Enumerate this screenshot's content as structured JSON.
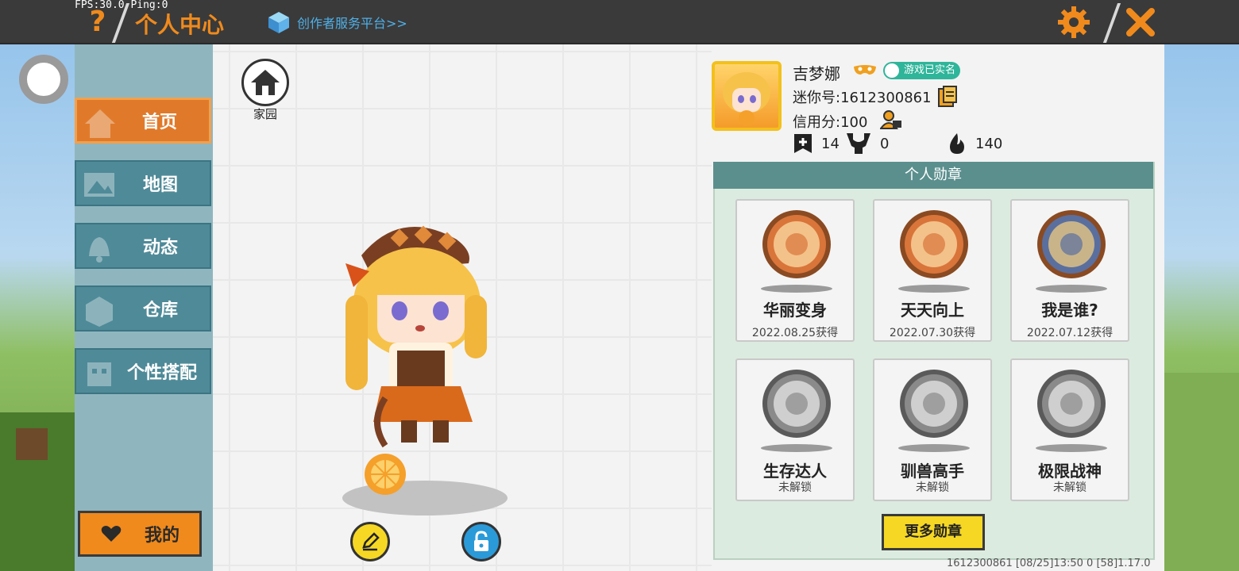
{
  "overlay": {
    "fps_text": "FPS:30.0  Ping:0"
  },
  "header": {
    "title": "个人中心",
    "help_glyph": "?",
    "creator_link": "创作者服务平台>>",
    "close_glyph": "✕"
  },
  "sidebar": {
    "items": [
      {
        "label": "首页",
        "icon": "house-icon",
        "active": true
      },
      {
        "label": "地图",
        "icon": "image-icon",
        "active": false
      },
      {
        "label": "动态",
        "icon": "bell-icon",
        "active": false
      },
      {
        "label": "仓库",
        "icon": "box-icon",
        "active": false
      },
      {
        "label": "个性搭配",
        "icon": "outfit-icon",
        "active": false
      }
    ],
    "my_button": {
      "label": "我的",
      "icon": "heart-icon"
    }
  },
  "center": {
    "home_label": "家园"
  },
  "profile": {
    "name": "吉梦娜",
    "verified_label": "游戏已实名",
    "mini_id": "迷你号:1612300861",
    "credit": "信用分:100",
    "stats": [
      {
        "icon": "flag-plus-icon",
        "value": "14"
      },
      {
        "icon": "trophy-icon",
        "value": "0"
      },
      {
        "icon": "flame-icon",
        "value": "140"
      }
    ]
  },
  "badges": {
    "header": "个人勋章",
    "items": [
      {
        "name": "华丽变身",
        "date": "2022.08.25获得",
        "unlocked": true,
        "color": "#d9753a"
      },
      {
        "name": "天天向上",
        "date": "2022.07.30获得",
        "unlocked": true,
        "color": "#d9753a"
      },
      {
        "name": "我是谁?",
        "date": "2022.07.12获得",
        "unlocked": true,
        "color": "#5a6f9e"
      },
      {
        "name": "生存达人",
        "date": "未解锁",
        "unlocked": false,
        "color": "#8a8a8a"
      },
      {
        "name": "驯兽高手",
        "date": "未解锁",
        "unlocked": false,
        "color": "#8a8a8a"
      },
      {
        "name": "极限战神",
        "date": "未解锁",
        "unlocked": false,
        "color": "#8a8a8a"
      }
    ],
    "more_label": "更多勋章"
  },
  "footer": {
    "info": "1612300861   [08/25]13:50 0  [58]1.17.0"
  },
  "colors": {
    "accent": "#f08a1c",
    "teal": "#4f8a98",
    "badge_panel": "#dcebdf",
    "yellow": "#f6d824"
  }
}
